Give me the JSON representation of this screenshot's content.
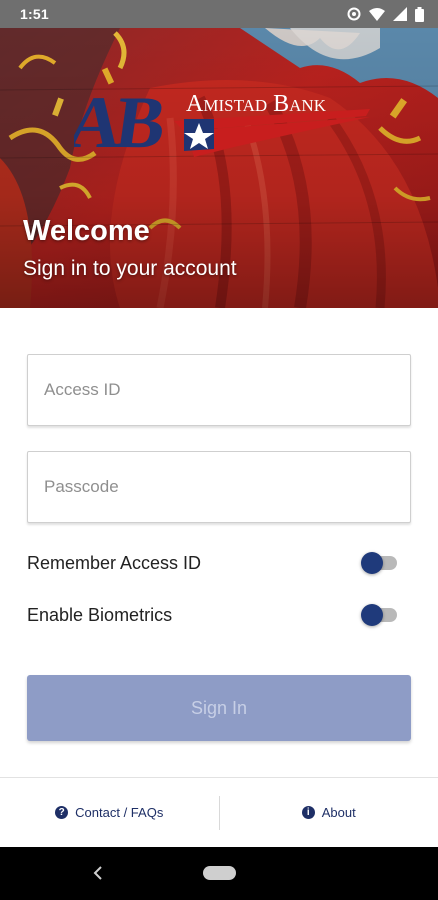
{
  "status_bar": {
    "time": "1:51",
    "icons": [
      "data-saver-icon",
      "wifi-icon",
      "signal-icon",
      "battery-icon"
    ]
  },
  "hero": {
    "logo_monogram": "AB",
    "logo_text": "Amistad Bank",
    "title": "Welcome",
    "subtitle": "Sign in to your account"
  },
  "form": {
    "access_id": {
      "placeholder": "Access ID",
      "value": ""
    },
    "passcode": {
      "placeholder": "Passcode",
      "value": ""
    },
    "toggles": [
      {
        "label": "Remember Access ID",
        "on": false
      },
      {
        "label": "Enable Biometrics",
        "on": false
      }
    ],
    "sign_in_label": "Sign In"
  },
  "footer": {
    "contact_label": "Contact / FAQs",
    "about_label": "About"
  },
  "colors": {
    "brand_navy": "#1e2f66",
    "button_disabled": "#8e9cc6",
    "hero_red": "#b51f1d"
  }
}
